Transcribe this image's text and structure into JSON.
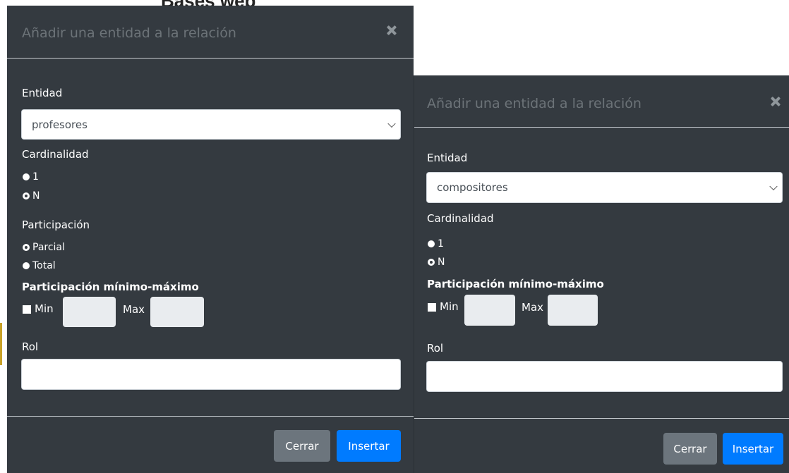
{
  "background_peek_text": "Bases web",
  "dialogs": [
    {
      "title": "Añadir una entidad a la relación",
      "entidad_label": "Entidad",
      "entidad_value": "profesores",
      "cardinalidad_label": "Cardinalidad",
      "cardinalidad_options": [
        "1",
        "N"
      ],
      "cardinalidad_selected": "N",
      "participacion_label": "Participación",
      "participacion_options": [
        "Parcial",
        "Total"
      ],
      "participacion_selected": "Parcial",
      "minmax_label": "Participación mínimo-máximo",
      "min_label": "Min",
      "max_label": "Max",
      "rol_label": "Rol",
      "cerrar_label": "Cerrar",
      "insertar_label": "Insertar"
    },
    {
      "title": "Añadir una entidad a la relación",
      "entidad_label": "Entidad",
      "entidad_value": "compositores",
      "cardinalidad_label": "Cardinalidad",
      "cardinalidad_options": [
        "1",
        "N"
      ],
      "cardinalidad_selected": "N",
      "minmax_label": "Participación mínimo-máximo",
      "min_label": "Min",
      "max_label": "Max",
      "rol_label": "Rol",
      "cerrar_label": "Cerrar",
      "insertar_label": "Insertar"
    }
  ],
  "colors": {
    "modal_bg": "#343a40",
    "title_text": "#6c7378",
    "primary": "#007bff",
    "secondary": "#6c757d",
    "input_disabled_bg": "#e9ecef"
  }
}
